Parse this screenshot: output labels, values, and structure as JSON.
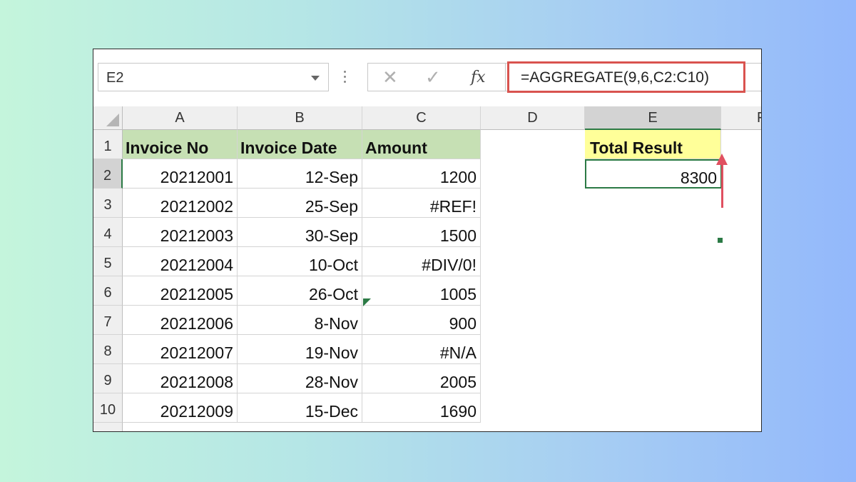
{
  "name_box": {
    "value": "E2"
  },
  "formula_bar": {
    "cancel_icon": "✕",
    "enter_icon": "✓",
    "fx_label": "fx",
    "formula": "=AGGREGATE(9,6,C2:C10)"
  },
  "columns": [
    "A",
    "B",
    "C",
    "D",
    "E",
    "F"
  ],
  "rows": [
    "1",
    "2",
    "3",
    "4",
    "5",
    "6",
    "7",
    "8",
    "9",
    "10"
  ],
  "table": {
    "headers": [
      "Invoice No",
      "Invoice Date",
      "Amount"
    ],
    "rows": [
      [
        "20212001",
        "12-Sep",
        "1200"
      ],
      [
        "20212002",
        "25-Sep",
        "#REF!"
      ],
      [
        "20212003",
        "30-Sep",
        "1500"
      ],
      [
        "20212004",
        "10-Oct",
        "#DIV/0!"
      ],
      [
        "20212005",
        "26-Oct",
        "1005"
      ],
      [
        "20212006",
        "8-Nov",
        "900"
      ],
      [
        "20212007",
        "19-Nov",
        "#N/A"
      ],
      [
        "20212008",
        "28-Nov",
        "2005"
      ],
      [
        "20212009",
        "15-Dec",
        "1690"
      ]
    ]
  },
  "result": {
    "label": "Total Result",
    "value": "8300"
  },
  "colors": {
    "header_fill": "#c6e0b4",
    "total_fill": "#ffff99",
    "selection": "#2b7a45",
    "highlight": "#d9534f"
  }
}
